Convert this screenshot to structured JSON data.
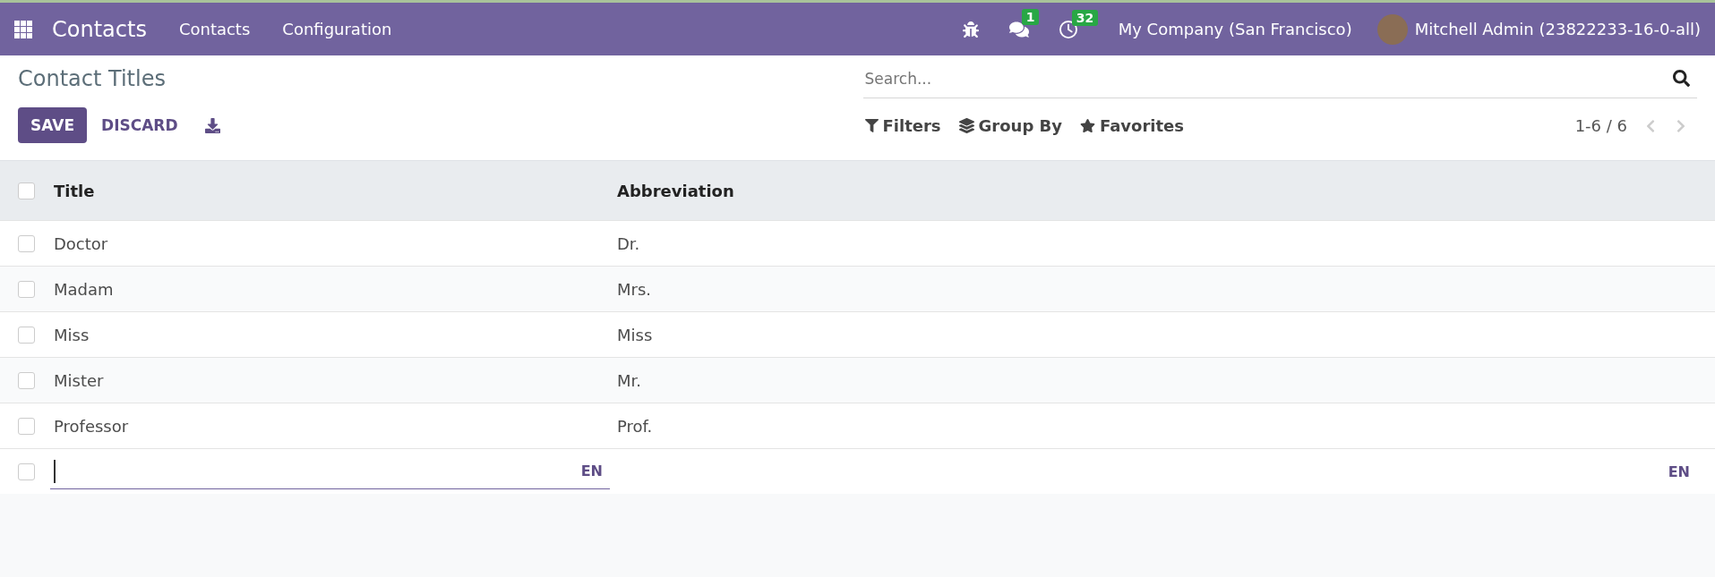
{
  "navbar": {
    "app_name": "Contacts",
    "menu": [
      "Contacts",
      "Configuration"
    ],
    "messages_badge": "1",
    "activities_badge": "32",
    "company": "My Company (San Francisco)",
    "user": "Mitchell Admin (23822233-16-0-all)"
  },
  "control_panel": {
    "title": "Contact Titles",
    "save": "SAVE",
    "discard": "DISCARD",
    "search": {
      "placeholder": "Search..."
    },
    "filters": "Filters",
    "group_by": "Group By",
    "favorites": "Favorites",
    "pager": "1-6 / 6"
  },
  "table": {
    "select_all_checked": false,
    "columns": [
      "Title",
      "Abbreviation"
    ],
    "rows": [
      {
        "title": "Doctor",
        "abbreviation": "Dr.",
        "checked": false
      },
      {
        "title": "Madam",
        "abbreviation": "Mrs.",
        "checked": false
      },
      {
        "title": "Miss",
        "abbreviation": "Miss",
        "checked": false
      },
      {
        "title": "Mister",
        "abbreviation": "Mr.",
        "checked": false
      },
      {
        "title": "Professor",
        "abbreviation": "Prof.",
        "checked": false
      }
    ],
    "new_row": {
      "checked": false,
      "title_lang": "EN",
      "abbreviation_lang": "EN"
    }
  }
}
